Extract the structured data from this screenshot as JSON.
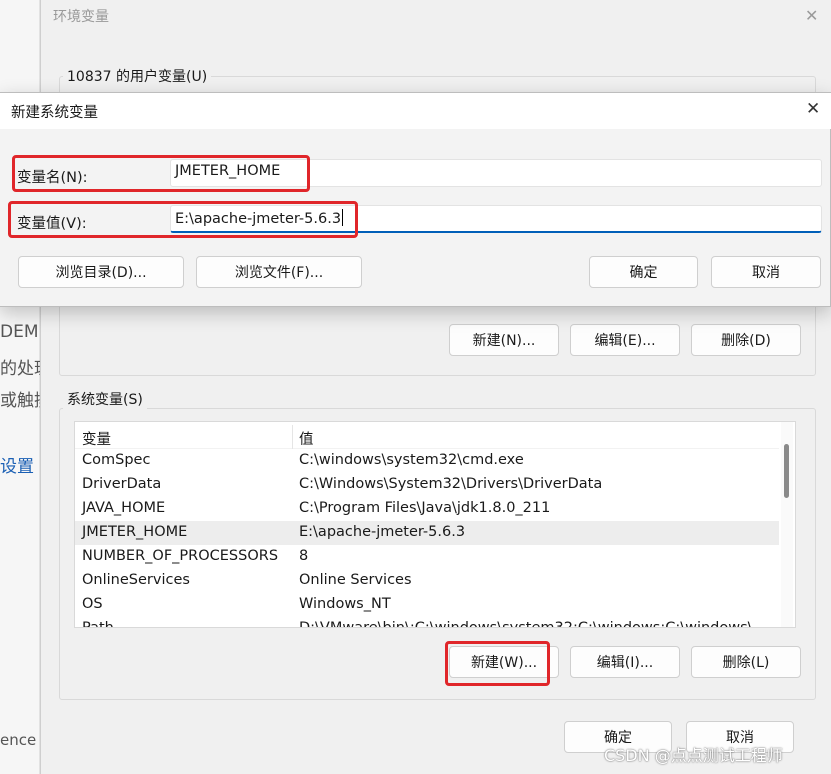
{
  "background": {
    "fragments": [
      "DEM",
      "的处理",
      "或触摸",
      "设置",
      "ence F"
    ]
  },
  "env_dialog": {
    "title": "环境变量",
    "close_icon": "close-icon",
    "user_group_label": "10837 的用户变量(U)",
    "user_buttons": {
      "new": "新建(N)...",
      "edit": "编辑(E)...",
      "delete": "删除(D)"
    },
    "system_group_label": "系统变量(S)",
    "system_table": {
      "headers": [
        "变量",
        "值"
      ],
      "rows": [
        {
          "name": "ComSpec",
          "value": "C:\\windows\\system32\\cmd.exe"
        },
        {
          "name": "DriverData",
          "value": "C:\\Windows\\System32\\Drivers\\DriverData"
        },
        {
          "name": "JAVA_HOME",
          "value": "C:\\Program Files\\Java\\jdk1.8.0_211"
        },
        {
          "name": "JMETER_HOME",
          "value": "E:\\apache-jmeter-5.6.3",
          "selected": true
        },
        {
          "name": "NUMBER_OF_PROCESSORS",
          "value": "8"
        },
        {
          "name": "OnlineServices",
          "value": "Online Services"
        },
        {
          "name": "OS",
          "value": "Windows_NT"
        },
        {
          "name": "Path",
          "value": "D:\\VMware\\bin\\;C:\\windows\\system32;C:\\windows;C:\\windows\\..."
        }
      ]
    },
    "system_buttons": {
      "new": "新建(W)...",
      "edit": "编辑(I)...",
      "delete": "删除(L)"
    },
    "footer": {
      "ok": "确定",
      "cancel": "取消"
    }
  },
  "new_var_dialog": {
    "title": "新建系统变量",
    "close_icon": "close-icon",
    "name_label": "变量名(N):",
    "name_value": "JMETER_HOME",
    "value_label": "变量值(V):",
    "value_value": "E:\\apache-jmeter-5.6.3",
    "buttons": {
      "browse_dir": "浏览目录(D)...",
      "browse_file": "浏览文件(F)...",
      "ok": "确定",
      "cancel": "取消"
    }
  },
  "watermark": "CSDN @点点测试工程师",
  "colors": {
    "highlight": "#e0262a",
    "focus": "#005fb8",
    "selected_row": "#ededed"
  }
}
